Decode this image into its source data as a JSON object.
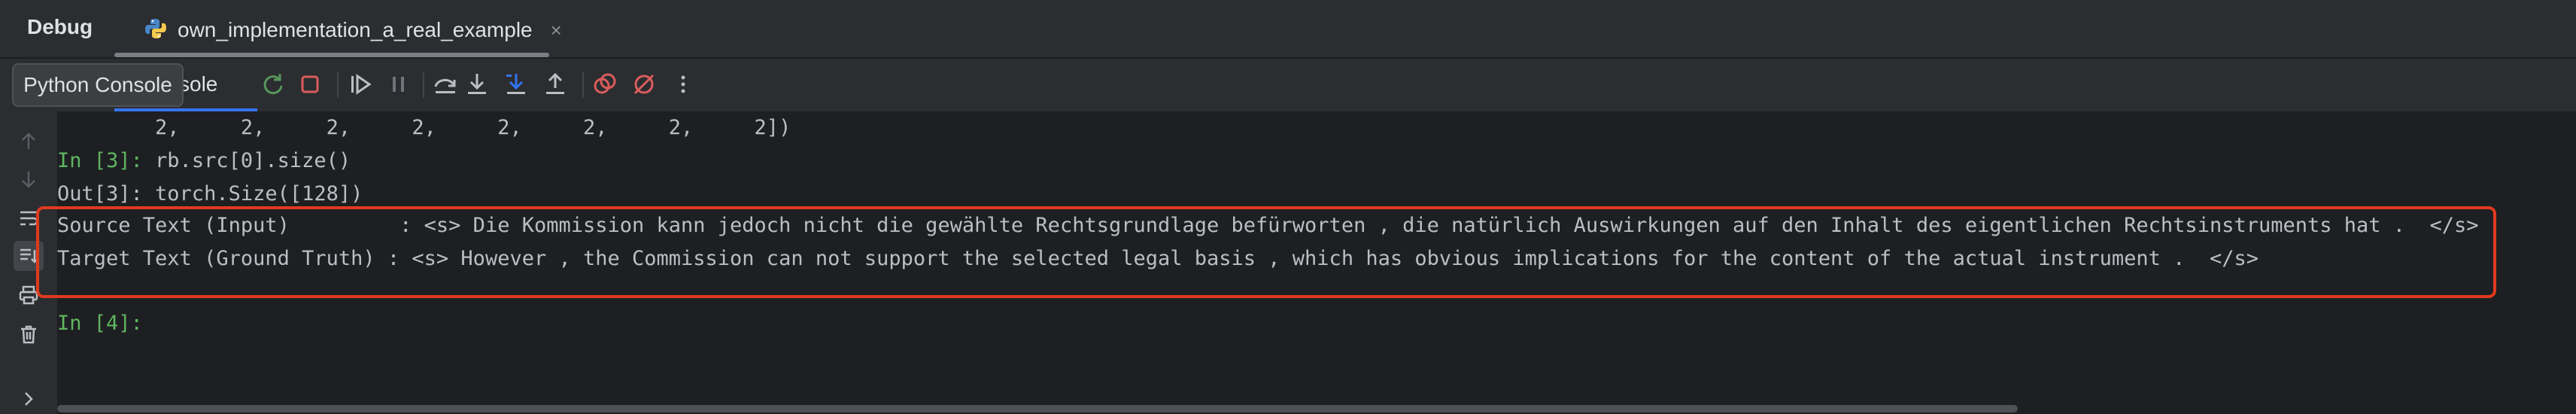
{
  "window": {
    "debug_title": "Debug",
    "tab_label": "own_implementation_a_real_example",
    "tab_close": "×"
  },
  "toolbar": {
    "tooltip": "Python Console",
    "visible_tab_fragment": "sole",
    "icons": [
      "rerun-icon",
      "stop-icon",
      "resume-icon",
      "pause-icon",
      "step-over-icon",
      "step-into-icon",
      "step-into-my-code-icon",
      "step-out-icon",
      "view-breakpoints-icon",
      "mute-breakpoints-icon",
      "more-icon"
    ],
    "colors": {
      "stop": "#db5c5c",
      "breakpoint": "#db5c5c",
      "accent": "#3574f0"
    }
  },
  "gutter": {
    "icons": [
      "arrow-up-icon",
      "arrow-down-icon",
      "soft-wrap-icon",
      "scroll-to-end-icon",
      "print-icon",
      "trash-icon",
      "expand-icon"
    ]
  },
  "console": {
    "lines": [
      {
        "text": "        2,     2,     2,     2,     2,     2,     2,     2])"
      },
      {
        "prompt": "In [3]: ",
        "text": "rb.src[0].size()"
      },
      {
        "text": "Out[3]: torch.Size([128])"
      },
      {
        "text": "Source Text (Input)         : <s> Die Kommission kann jedoch nicht die gewählte Rechtsgrundlage befürworten , die natürlich Auswirkungen auf den Inhalt des eigentlichen Rechtsinstruments hat .  </s>"
      },
      {
        "text": "Target Text (Ground Truth) : <s> However , the Commission can not support the selected legal basis , which has obvious implications for the content of the actual instrument .  </s>"
      },
      {
        "prompt": "In [4]: ",
        "text": ""
      }
    ],
    "highlight_color": "#e03a1e"
  }
}
